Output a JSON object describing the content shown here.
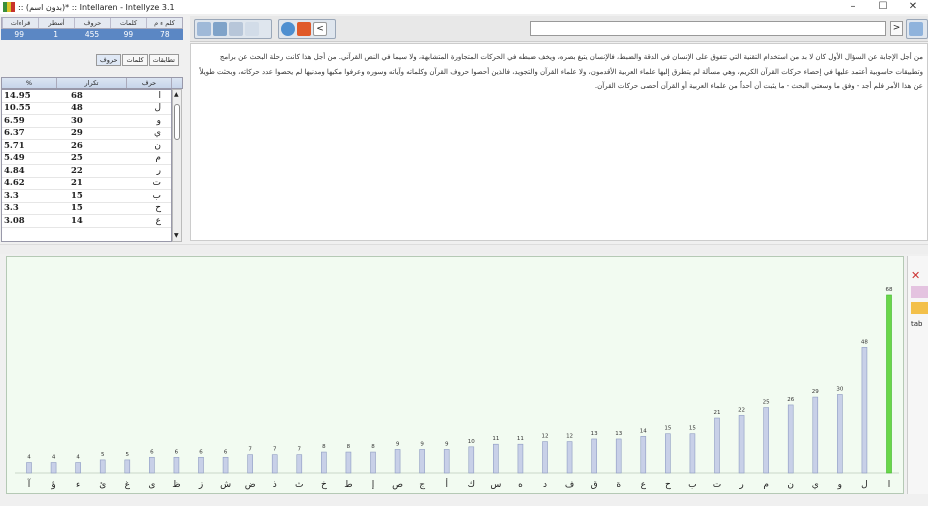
{
  "window": {
    "title": ":: (بدون اسم)* :: Intellaren - Intellyze 3.1",
    "minimize_glyph": "–",
    "maximize_glyph": "☐",
    "close_glyph": "✕"
  },
  "stats": {
    "headers": [
      "قراءات",
      "أسطر",
      "حروف",
      "كلمات",
      "كلم ء م"
    ],
    "values": [
      "99",
      "1",
      "455",
      "99",
      "78"
    ]
  },
  "subtabs": [
    "حروف",
    "كلمات",
    "تطابقات"
  ],
  "freq_table": {
    "headers": {
      "percent": "%",
      "count": "تكرار",
      "letter": "حرف"
    },
    "rows": [
      {
        "percent": "14.95",
        "count": "68",
        "letter": "ا"
      },
      {
        "percent": "10.55",
        "count": "48",
        "letter": "ل"
      },
      {
        "percent": "6.59",
        "count": "30",
        "letter": "و"
      },
      {
        "percent": "6.37",
        "count": "29",
        "letter": "ي"
      },
      {
        "percent": "5.71",
        "count": "26",
        "letter": "ن"
      },
      {
        "percent": "5.49",
        "count": "25",
        "letter": "م"
      },
      {
        "percent": "4.84",
        "count": "22",
        "letter": "ر"
      },
      {
        "percent": "4.62",
        "count": "21",
        "letter": "ت"
      },
      {
        "percent": "3.3",
        "count": "15",
        "letter": "ب"
      },
      {
        "percent": "3.3",
        "count": "15",
        "letter": "ح"
      },
      {
        "percent": "3.08",
        "count": "14",
        "letter": "ع"
      }
    ]
  },
  "toolbar": {
    "back_glyph": "<",
    "forward_glyph": ">"
  },
  "text": {
    "paragraph": "من أجل الإجابة عن السؤال الأول كان لا بد من استخدام التقنية التي تتفوق على الإنسان في الدقة والضبط، فالإنسان يتيغ بصره، ويخف ضبطه في الحركات المتجاورة المتشابهة، ولا سيما في النص القرآني. من أجل هذا كانت رحلة البحث عن برامج وتطبيقات حاسوبية أعتمد عليها في إحصاء حركات القرآن الكريم، وهي مسألة لم يتطرق إليها علماء العربية الأقدمون، ولا علماء القرآن والتجويد، فالذين أحصوا حروف القرآن وكلماته وآياته وسوره وعرفوا مكيها ومدنيها لم يحصوا عدد حركاته، وبحثت طويلاً عن هذا الأمر فلم أجد - وفق ما وسعني البحث - ما يثبت أن أحداً من علماء العربية أو القرآن أحصى حركات القرآن."
  },
  "right_strip": {
    "item_label": "tab"
  },
  "chart_data": {
    "type": "bar",
    "categories": [
      "ا",
      "ل",
      "و",
      "ي",
      "ن",
      "م",
      "ر",
      "ت",
      "ب",
      "ح",
      "ع",
      "ة",
      "ق",
      "ف",
      "د",
      "ه",
      "س",
      "ك",
      "أ",
      "ج",
      "ص",
      "إ",
      "ط",
      "خ",
      "ث",
      "ذ",
      "ض",
      "ش",
      "ز",
      "ظ",
      "ى",
      "غ",
      "ئ",
      "ء",
      "ؤ",
      "آ"
    ],
    "values": [
      68,
      48,
      30,
      29,
      26,
      25,
      22,
      21,
      15,
      15,
      14,
      13,
      13,
      12,
      12,
      11,
      11,
      10,
      9,
      9,
      9,
      8,
      8,
      8,
      7,
      7,
      7,
      6,
      6,
      6,
      6,
      5,
      5,
      4,
      4,
      4
    ],
    "highlight_color": "#6ad64a",
    "bar_color": "#c8d0e8",
    "grid": false
  }
}
